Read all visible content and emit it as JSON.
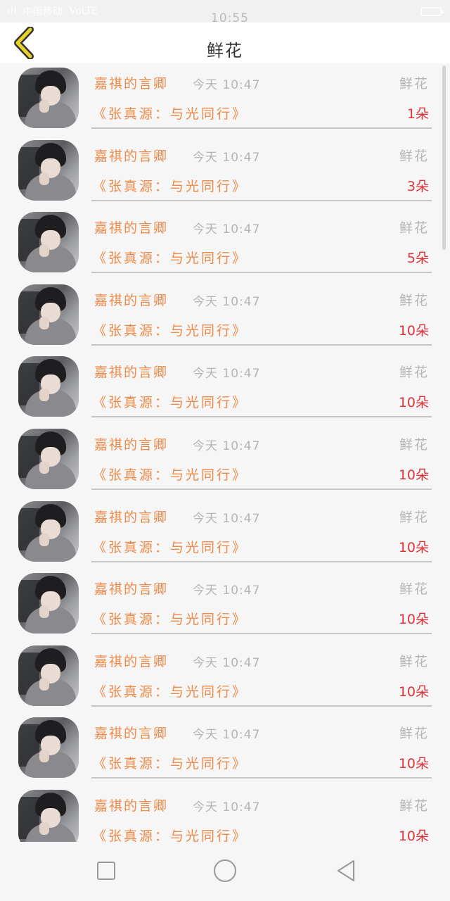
{
  "status_bar": {
    "signal": "ıll",
    "carrier": "中国移动",
    "network": "VoLTE",
    "time": "10:55"
  },
  "header": {
    "title": "鲜花",
    "back_icon": "chevron-left-icon",
    "accent": "#e8d22a"
  },
  "colors": {
    "name": "#ef8a48",
    "muted": "#b5b5b5",
    "count": "#e1323a"
  },
  "records": [
    {
      "name": "嘉祺的言卿",
      "time": "今天 10:47",
      "gift_type": "鲜花",
      "work_title": "《张真源：与光同行》",
      "count": "1朵"
    },
    {
      "name": "嘉祺的言卿",
      "time": "今天 10:47",
      "gift_type": "鲜花",
      "work_title": "《张真源：与光同行》",
      "count": "3朵"
    },
    {
      "name": "嘉祺的言卿",
      "time": "今天 10:47",
      "gift_type": "鲜花",
      "work_title": "《张真源：与光同行》",
      "count": "5朵"
    },
    {
      "name": "嘉祺的言卿",
      "time": "今天 10:47",
      "gift_type": "鲜花",
      "work_title": "《张真源：与光同行》",
      "count": "10朵"
    },
    {
      "name": "嘉祺的言卿",
      "time": "今天 10:47",
      "gift_type": "鲜花",
      "work_title": "《张真源：与光同行》",
      "count": "10朵"
    },
    {
      "name": "嘉祺的言卿",
      "time": "今天 10:47",
      "gift_type": "鲜花",
      "work_title": "《张真源：与光同行》",
      "count": "10朵"
    },
    {
      "name": "嘉祺的言卿",
      "time": "今天 10:47",
      "gift_type": "鲜花",
      "work_title": "《张真源：与光同行》",
      "count": "10朵"
    },
    {
      "name": "嘉祺的言卿",
      "time": "今天 10:47",
      "gift_type": "鲜花",
      "work_title": "《张真源：与光同行》",
      "count": "10朵"
    },
    {
      "name": "嘉祺的言卿",
      "time": "今天 10:47",
      "gift_type": "鲜花",
      "work_title": "《张真源：与光同行》",
      "count": "10朵"
    },
    {
      "name": "嘉祺的言卿",
      "time": "今天 10:47",
      "gift_type": "鲜花",
      "work_title": "《张真源：与光同行》",
      "count": "10朵"
    },
    {
      "name": "嘉祺的言卿",
      "time": "今天 10:47",
      "gift_type": "鲜花",
      "work_title": "《张真源：与光同行》",
      "count": "10朵"
    }
  ],
  "nav_bar": {
    "recent_icon": "square-icon",
    "home_icon": "circle-icon",
    "back_icon": "triangle-back-icon"
  }
}
